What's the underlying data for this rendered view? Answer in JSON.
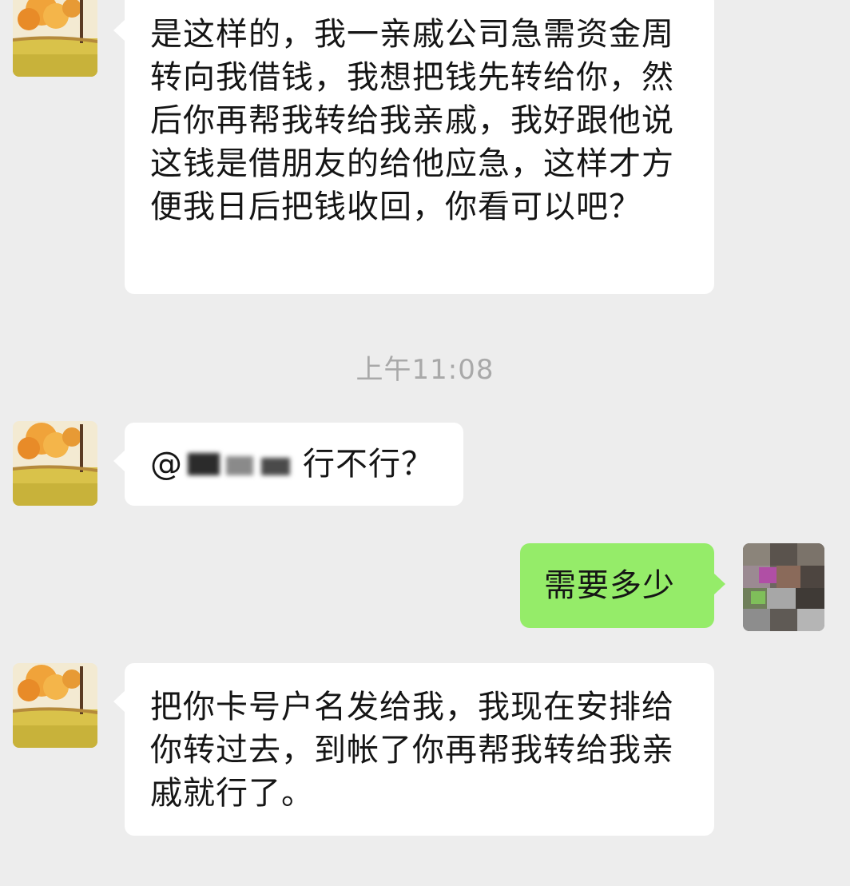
{
  "chat": {
    "timestamp": "上午11:08",
    "messages": [
      {
        "sender": "contact",
        "text": "是这样的，我一亲戚公司急需资金周转向我借钱，我想把钱先转给你，然后你再帮我转给我亲戚，我好跟他说这钱是借朋友的给他应急，这样才方便我日后把钱收回，你看可以吧？"
      },
      {
        "sender": "contact",
        "mention_prefix": "@",
        "text": "行不行？"
      },
      {
        "sender": "me",
        "text": "需要多少"
      },
      {
        "sender": "contact",
        "text": "把你卡号户名发给我，我现在安排给你转过去，到帐了你再帮我转给我亲戚就行了。"
      }
    ]
  },
  "colors": {
    "background": "#ededed",
    "incoming_bubble": "#ffffff",
    "outgoing_bubble": "#95ec69",
    "timestamp_text": "#a9a9a9"
  }
}
